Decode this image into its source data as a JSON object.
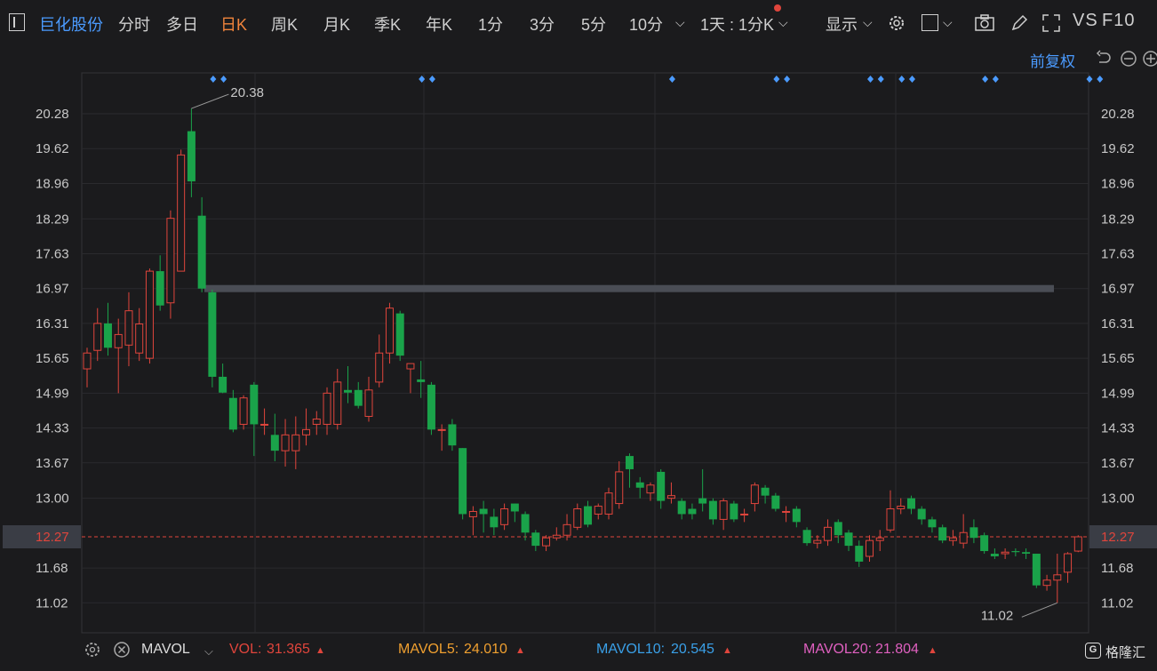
{
  "toolbar": {
    "stock_name": "巨化股份",
    "tabs": [
      "分时",
      "多日",
      "日K",
      "周K",
      "月K",
      "季K",
      "年K",
      "1分",
      "3分",
      "5分",
      "10分"
    ],
    "active_tab": "日K",
    "period_select": "1天 : 1分K",
    "display_label": "显示",
    "vs_label": "VS",
    "f10_label": "F10"
  },
  "sub_toolbar": {
    "adjust_label": "前复权"
  },
  "colors": {
    "up": "#e0453c",
    "down": "#1aa34a",
    "accent": "#4b9bff",
    "active": "#f0843c",
    "bg": "#1b1b1d"
  },
  "chart_data": {
    "type": "candlestick",
    "y_ticks": [
      "20.28",
      "19.62",
      "18.96",
      "18.29",
      "17.63",
      "16.97",
      "16.31",
      "15.65",
      "14.99",
      "14.33",
      "13.67",
      "13.00",
      "12.27",
      "11.68",
      "11.02"
    ],
    "ylim": [
      10.5,
      20.9
    ],
    "current_price": "12.27",
    "high_label": "20.38",
    "low_label": "11.02",
    "resistance_level": 16.97,
    "candles": [
      [
        15.45,
        15.75,
        15.1,
        15.85
      ],
      [
        15.8,
        16.31,
        15.6,
        16.6
      ],
      [
        16.31,
        15.85,
        15.7,
        16.7
      ],
      [
        15.85,
        16.1,
        14.99,
        16.4
      ],
      [
        15.9,
        16.55,
        15.5,
        16.9
      ],
      [
        15.75,
        16.3,
        15.6,
        16.6
      ],
      [
        15.65,
        17.3,
        15.55,
        17.35
      ],
      [
        17.3,
        16.65,
        16.55,
        17.6
      ],
      [
        16.7,
        18.3,
        16.4,
        18.45
      ],
      [
        17.3,
        19.5,
        17.3,
        19.6
      ],
      [
        19.95,
        19.0,
        18.7,
        20.38
      ],
      [
        18.35,
        16.97,
        16.9,
        18.7
      ],
      [
        16.9,
        15.3,
        15.1,
        16.95
      ],
      [
        15.3,
        15.0,
        14.99,
        15.55
      ],
      [
        14.9,
        14.3,
        14.25,
        15.05
      ],
      [
        14.4,
        14.9,
        14.3,
        14.95
      ],
      [
        15.15,
        14.4,
        13.8,
        15.2
      ],
      [
        14.4,
        14.4,
        14.2,
        14.7
      ],
      [
        14.2,
        13.9,
        13.7,
        14.6
      ],
      [
        13.9,
        14.2,
        13.6,
        14.5
      ],
      [
        13.9,
        14.2,
        13.55,
        14.55
      ],
      [
        14.2,
        14.3,
        14.0,
        14.7
      ],
      [
        14.4,
        14.5,
        14.2,
        14.65
      ],
      [
        14.4,
        14.99,
        14.2,
        15.1
      ],
      [
        14.4,
        15.2,
        14.3,
        15.45
      ],
      [
        15.05,
        15.0,
        14.8,
        15.5
      ],
      [
        15.05,
        14.75,
        14.7,
        15.2
      ],
      [
        14.55,
        15.05,
        14.45,
        15.3
      ],
      [
        15.2,
        15.75,
        15.1,
        16.1
      ],
      [
        15.75,
        16.6,
        15.55,
        16.7
      ],
      [
        16.5,
        15.7,
        15.6,
        16.55
      ],
      [
        15.45,
        15.55,
        14.99,
        15.55
      ],
      [
        15.25,
        15.2,
        14.9,
        15.6
      ],
      [
        15.15,
        14.3,
        14.2,
        15.2
      ],
      [
        14.3,
        14.3,
        13.9,
        14.4
      ],
      [
        14.4,
        14.0,
        13.9,
        14.5
      ],
      [
        13.95,
        12.7,
        12.6,
        13.95
      ],
      [
        12.65,
        12.75,
        12.3,
        12.85
      ],
      [
        12.8,
        12.7,
        12.35,
        12.95
      ],
      [
        12.65,
        12.45,
        12.3,
        12.8
      ],
      [
        12.5,
        12.8,
        12.4,
        12.9
      ],
      [
        12.9,
        12.75,
        12.55,
        12.9
      ],
      [
        12.7,
        12.35,
        12.2,
        12.75
      ],
      [
        12.35,
        12.1,
        12.0,
        12.4
      ],
      [
        12.1,
        12.25,
        12.0,
        12.3
      ],
      [
        12.25,
        12.3,
        12.2,
        12.45
      ],
      [
        12.3,
        12.5,
        12.2,
        12.7
      ],
      [
        12.45,
        12.8,
        12.4,
        12.9
      ],
      [
        12.85,
        12.5,
        12.45,
        12.95
      ],
      [
        12.7,
        12.85,
        12.6,
        12.9
      ],
      [
        12.7,
        13.1,
        12.6,
        13.2
      ],
      [
        12.9,
        13.5,
        12.8,
        13.7
      ],
      [
        13.8,
        13.55,
        13.2,
        13.85
      ],
      [
        13.3,
        13.2,
        13.0,
        13.4
      ],
      [
        13.1,
        13.25,
        12.95,
        13.3
      ],
      [
        13.5,
        12.95,
        12.8,
        13.55
      ],
      [
        13.0,
        13.05,
        12.9,
        13.3
      ],
      [
        12.95,
        12.7,
        12.6,
        13.0
      ],
      [
        12.8,
        12.7,
        12.6,
        12.9
      ],
      [
        13.0,
        12.9,
        12.75,
        13.55
      ],
      [
        12.95,
        12.6,
        12.5,
        13.0
      ],
      [
        12.6,
        12.95,
        12.4,
        13.0
      ],
      [
        12.9,
        12.6,
        12.55,
        12.95
      ],
      [
        12.7,
        12.7,
        12.55,
        12.8
      ],
      [
        12.9,
        13.25,
        12.75,
        13.3
      ],
      [
        13.2,
        13.05,
        12.9,
        13.25
      ],
      [
        13.05,
        12.8,
        12.75,
        13.1
      ],
      [
        12.75,
        12.75,
        12.55,
        12.85
      ],
      [
        12.8,
        12.55,
        12.45,
        12.85
      ],
      [
        12.4,
        12.15,
        12.1,
        12.45
      ],
      [
        12.15,
        12.2,
        12.05,
        12.3
      ],
      [
        12.2,
        12.45,
        12.1,
        12.6
      ],
      [
        12.55,
        12.3,
        12.15,
        12.6
      ],
      [
        12.35,
        12.1,
        12.0,
        12.4
      ],
      [
        12.1,
        11.8,
        11.7,
        12.2
      ],
      [
        11.9,
        12.2,
        11.8,
        12.3
      ],
      [
        12.2,
        12.25,
        12.0,
        12.4
      ],
      [
        12.4,
        12.8,
        12.35,
        13.15
      ],
      [
        12.8,
        12.85,
        12.7,
        13.0
      ],
      [
        13.0,
        12.8,
        12.7,
        13.05
      ],
      [
        12.8,
        12.6,
        12.5,
        12.85
      ],
      [
        12.6,
        12.45,
        12.35,
        12.65
      ],
      [
        12.45,
        12.2,
        12.15,
        12.5
      ],
      [
        12.2,
        12.25,
        12.1,
        12.4
      ],
      [
        12.15,
        12.35,
        12.05,
        12.7
      ],
      [
        12.45,
        12.25,
        12.15,
        12.6
      ],
      [
        12.3,
        12.0,
        11.95,
        12.35
      ],
      [
        11.95,
        11.9,
        11.85,
        12.05
      ],
      [
        11.95,
        11.98,
        11.85,
        12.05
      ],
      [
        12.0,
        11.98,
        11.9,
        12.05
      ],
      [
        11.98,
        11.95,
        11.85,
        12.05
      ],
      [
        11.95,
        11.35,
        11.3,
        11.95
      ],
      [
        11.35,
        11.45,
        11.25,
        11.55
      ],
      [
        11.45,
        11.55,
        11.02,
        11.95
      ],
      [
        11.6,
        11.95,
        11.4,
        11.98
      ],
      [
        12.0,
        12.27,
        11.98,
        12.3
      ]
    ],
    "markers": [
      12,
      13,
      32,
      33,
      56,
      66,
      67,
      75,
      76,
      78,
      79,
      86,
      87,
      96,
      97
    ]
  },
  "bottom_bar": {
    "indicator_name": "MAVOL",
    "vol_label": "VOL:",
    "vol_value": "31.365",
    "mavol5_label": "MAVOL5:",
    "mavol5_value": "24.010",
    "mavol10_label": "MAVOL10:",
    "mavol10_value": "20.545",
    "mavol20_label": "MAVOL20:",
    "mavol20_value": "21.804",
    "colors": {
      "vol": "#e0453c",
      "mavol5": "#f0a030",
      "mavol10": "#3aa0e8",
      "mavol20": "#e060c0"
    }
  },
  "watermark": "格隆汇"
}
